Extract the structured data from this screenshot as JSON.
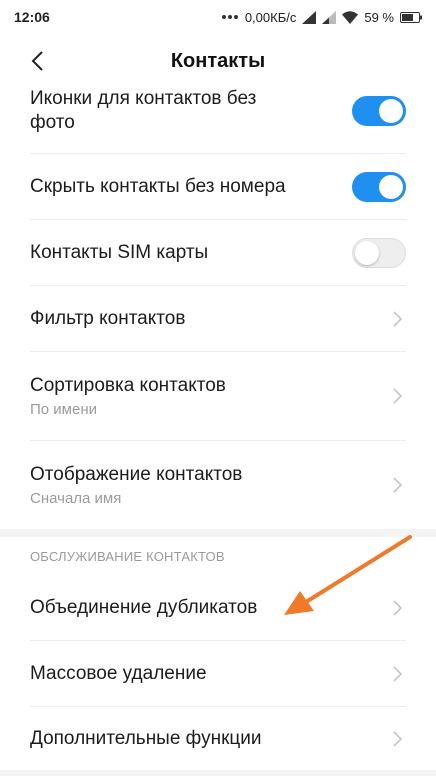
{
  "status_bar": {
    "time": "12:06",
    "network_speed": "0,00КБ/с",
    "battery_percent": "59 %"
  },
  "header": {
    "title": "Контакты",
    "back_icon": "chevron-left-icon"
  },
  "settings": {
    "icons_without_photo": {
      "title_line1": "Иконки для контактов без",
      "title_line2": "фото",
      "enabled": true
    },
    "hide_without_number": {
      "title": "Скрыть контакты без номера",
      "enabled": true
    },
    "sim_contacts": {
      "title": "Контакты SIM карты",
      "enabled": false
    },
    "filter": {
      "title": "Фильтр контактов"
    },
    "sorting": {
      "title": "Сортировка контактов",
      "value": "По имени"
    },
    "display": {
      "title": "Отображение контактов",
      "value": "Сначала имя"
    }
  },
  "maintenance": {
    "section_title": "ОБСЛУЖИВАНИЕ КОНТАКТОВ",
    "merge_duplicates": "Объединение дубликатов",
    "bulk_delete": "Массовое удаление",
    "extra_functions": "Дополнительные функции"
  },
  "colors": {
    "toggle_on": "#1f8ff0",
    "annotation_arrow": "#f07a2a"
  }
}
